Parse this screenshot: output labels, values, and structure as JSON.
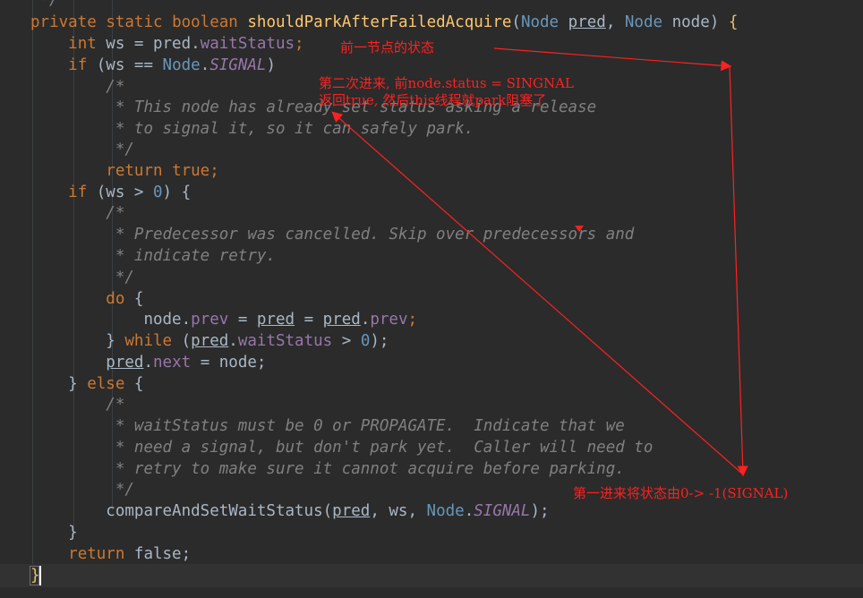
{
  "code": {
    "line0": {
      "comment_end": " */"
    },
    "line1": {
      "private": "private",
      "static": "static",
      "boolean": "boolean",
      "method": "shouldParkAfterFailedAcquire",
      "paren_open": "(",
      "type1": "Node",
      "param1": "pred",
      "comma": ", ",
      "type2": "Node",
      "param2": "node",
      "paren_close": ") ",
      "brace": "{"
    },
    "line2": {
      "int": "int",
      "rest": " ws = pred.",
      "field": "waitStatus",
      "semi": ";"
    },
    "line3": {
      "if": "if",
      "cond_open": " (ws == ",
      "type": "Node",
      "dot": ".",
      "const": "SIGNAL",
      "cond_close": ")"
    },
    "line4": {
      "comment": "/*"
    },
    "line5": {
      "comment": " * This node has already set status asking a release"
    },
    "line6": {
      "comment": " * to signal it, so it can safely park."
    },
    "line7": {
      "comment": " */"
    },
    "line8": {
      "return": "return",
      "value": "true",
      "semi": ";"
    },
    "line9": {
      "if": "if",
      "cond_open": " (ws > ",
      "zero": "0",
      "cond_close": ") {"
    },
    "line10": {
      "comment": "/*"
    },
    "line11": {
      "comment": " * Predecessor was cancelled. Skip over predecessors and"
    },
    "line12": {
      "comment": " * indicate retry."
    },
    "line13": {
      "comment": " */"
    },
    "line14": {
      "do": "do",
      "brace": " {"
    },
    "line15": {
      "node": "node.",
      "prev1": "prev",
      "eq1": " = ",
      "pred1": "pred",
      "eq2": " = ",
      "pred2": "pred",
      "dot": ".",
      "prev2": "prev",
      "semi": ";"
    },
    "line16": {
      "close": "} ",
      "while": "while",
      "open": " (",
      "pred": "pred",
      "dot": ".",
      "field": "waitStatus",
      "gt": " > ",
      "zero": "0",
      "end": ");"
    },
    "line17": {
      "pred": "pred",
      "dot": ".",
      "next": "next",
      "rest": " = node;"
    },
    "line18": {
      "close": "} ",
      "else": "else",
      "brace": " {"
    },
    "line19": {
      "comment": "/*"
    },
    "line20": {
      "comment": " * waitStatus must be 0 or PROPAGATE.  Indicate that we"
    },
    "line21": {
      "comment": " * need a signal, but don't park yet.  Caller will need to"
    },
    "line22": {
      "comment": " * retry to make sure it cannot acquire before parking."
    },
    "line23": {
      "comment": " */"
    },
    "line24": {
      "call": "compareAndSetWaitStatus(",
      "pred": "pred",
      "args": ", ws, ",
      "type": "Node",
      "dot": ".",
      "const": "SIGNAL",
      "end": ");"
    },
    "line25": {
      "close": "}"
    },
    "line26": {
      "return": "return",
      "value": " false;"
    },
    "line27": {
      "brace": "}"
    }
  },
  "annotations": {
    "prev_node_state": "前一节点的状态",
    "second_entry_line1": "第二次进来, 前node.status = SINGNAL",
    "second_entry_line2": "返回true, 然后this线程就park阻塞了",
    "first_entry": "第一进来将状态由0-> -1(SIGNAL)"
  },
  "colors": {
    "background": "#2b2b2b",
    "keyword": "#cc7832",
    "method": "#ffc66d",
    "field": "#9876aa",
    "comment": "#808080",
    "annotation": "#ff2020"
  }
}
